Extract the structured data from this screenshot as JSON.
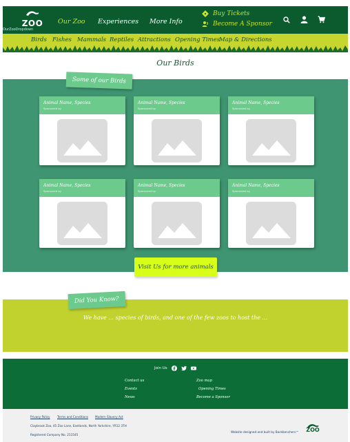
{
  "header": {
    "logo_text": "ZOO",
    "nav": [
      "Our Zoo",
      "Experiences",
      "More Info"
    ],
    "actions": [
      {
        "label": "Buy Tickets",
        "icon": "ticket-icon"
      },
      {
        "label": "Become A Sponsor",
        "icon": "sponsor-icon"
      }
    ],
    "icons": [
      "search-icon",
      "user-icon",
      "cart-icon"
    ],
    "dropdown_label": "OurZooDropdown"
  },
  "subnav": [
    "Birds",
    "Fishes",
    "Mammals",
    "Reptiles",
    "Attractions",
    "Opening Times",
    "Map & Directions"
  ],
  "page_title": "Our Birds",
  "section_tag": "Some of our Birds",
  "cards": [
    {
      "name": "Animal Name, Species",
      "sponsor": "Sponsored by"
    },
    {
      "name": "Animal Name, Species",
      "sponsor": "Sponsored by"
    },
    {
      "name": "Animal Name, Species",
      "sponsor": "Sponsored by"
    },
    {
      "name": "Animal Name, Species",
      "sponsor": "Sponsored by"
    },
    {
      "name": "Animal Name, Species",
      "sponsor": "Sponsored by"
    },
    {
      "name": "Animal Name, Species",
      "sponsor": "Sponsored by"
    }
  ],
  "cta_label": "Visit Us for more animals",
  "fact": {
    "tag": "Did You Know?",
    "text": "We have ... species of birds, and one of the few zoos to host the ..."
  },
  "footer": {
    "join_label": "Join Us",
    "social": [
      "facebook-icon",
      "twitter-icon",
      "youtube-icon"
    ],
    "links_left": [
      "Contact us",
      "Events",
      "News"
    ],
    "links_right": [
      "Zoo map",
      "Opening Times",
      "Become a Sponsor"
    ]
  },
  "legal": {
    "links": [
      "Privacy Policy",
      "Terms and Conditions",
      "Modern Slavery Act"
    ],
    "address": "Claybrook Zoo, 45 Zoo Lane, Eastlands, North Yorkshire, YR12 3TH",
    "company": "Registered Company No. 211545",
    "credit": "Website designed and built by Backbenchers™"
  },
  "colors": {
    "header_bg": "#0c5b2f",
    "accent": "#c6e22a",
    "band_green": "#3f9571",
    "card_head": "#6cca8d",
    "cta_bg": "#d8ff1a",
    "band_yellow": "#c1d22e",
    "footer_bg": "#0c6e36"
  }
}
